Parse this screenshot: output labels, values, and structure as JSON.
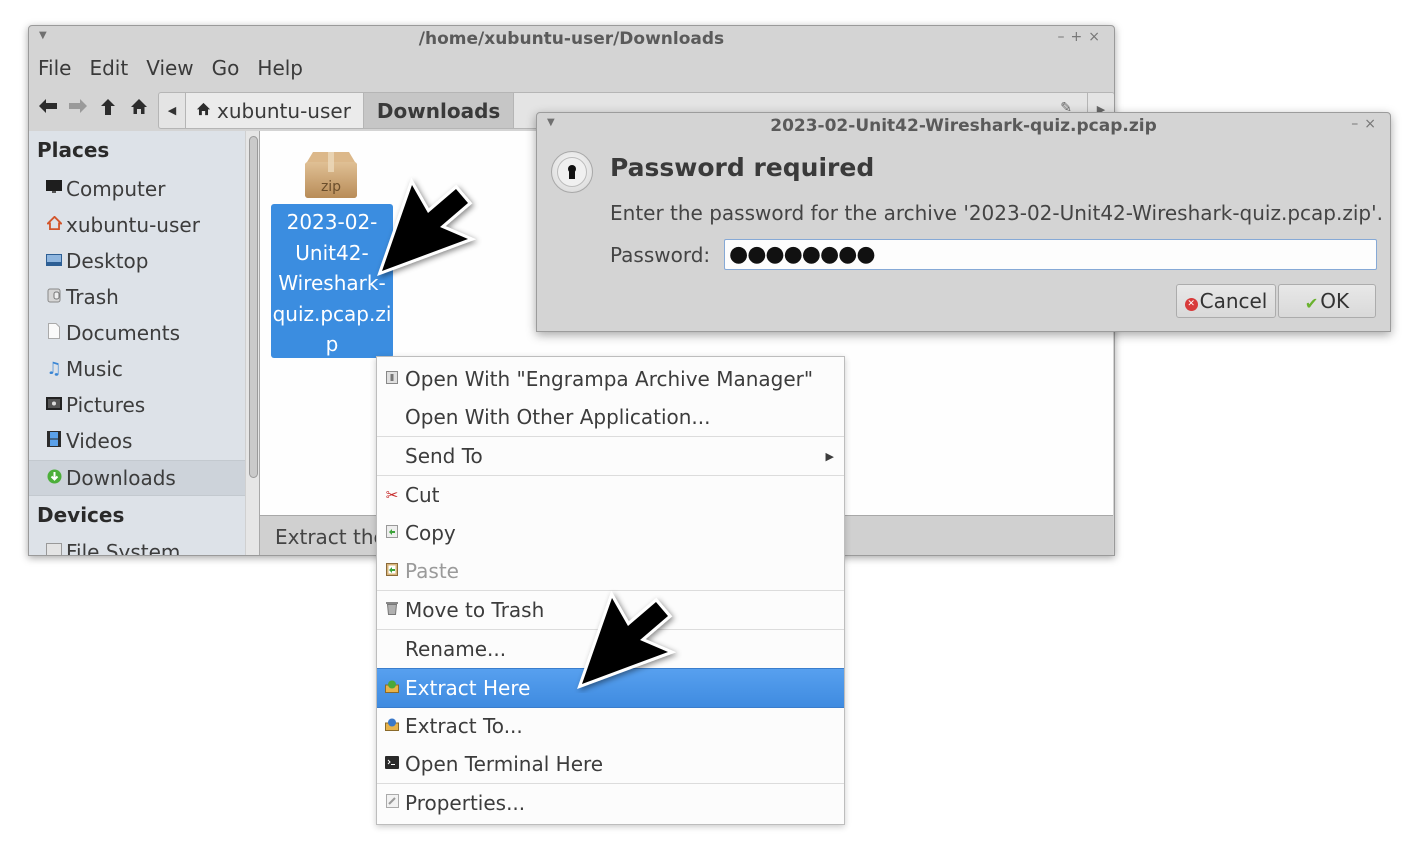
{
  "file_manager": {
    "window_title": "/home/xubuntu-user/Downloads",
    "window_controls": [
      "–",
      "+",
      "×"
    ],
    "menubar": [
      "File",
      "Edit",
      "View",
      "Go",
      "Help"
    ],
    "toolbar": {
      "back_icon": "arrow-left-icon",
      "forward_icon": "arrow-right-icon",
      "up_icon": "arrow-up-icon",
      "home_icon": "home-icon"
    },
    "pathbar": {
      "home_crumb": "xubuntu-user",
      "current_crumb": "Downloads"
    },
    "sidebar": {
      "places_header": "Places",
      "places": [
        {
          "label": "Computer",
          "icon": "computer-icon"
        },
        {
          "label": "xubuntu-user",
          "icon": "home-folder-icon"
        },
        {
          "label": "Desktop",
          "icon": "desktop-icon"
        },
        {
          "label": "Trash",
          "icon": "trash-icon"
        },
        {
          "label": "Documents",
          "icon": "document-icon"
        },
        {
          "label": "Music",
          "icon": "music-icon"
        },
        {
          "label": "Pictures",
          "icon": "pictures-icon"
        },
        {
          "label": "Videos",
          "icon": "videos-icon"
        },
        {
          "label": "Downloads",
          "icon": "downloads-icon",
          "active": true
        }
      ],
      "devices_header": "Devices",
      "devices": [
        {
          "label": "File System",
          "icon": "drive-icon"
        }
      ]
    },
    "files": [
      {
        "name_lines": [
          "2023-02-",
          "Unit42-",
          "Wireshark-",
          "quiz.pcap.zi",
          "p"
        ],
        "name": "2023-02-Unit42-Wireshark-quiz.pcap.zip",
        "type_badge": "zip",
        "selected": true
      }
    ],
    "statusbar": "Extract the"
  },
  "context_menu": {
    "items": [
      {
        "label": "Open With \"Engrampa Archive Manager\"",
        "icon": "archive-manager-icon"
      },
      {
        "label": "Open With Other Application...",
        "icon": ""
      },
      {
        "separator": true
      },
      {
        "label": "Send To",
        "icon": "",
        "submenu": true
      },
      {
        "separator": true
      },
      {
        "label": "Cut",
        "icon": "scissors-icon"
      },
      {
        "label": "Copy",
        "icon": "copy-icon"
      },
      {
        "label": "Paste",
        "icon": "paste-icon",
        "disabled": true
      },
      {
        "separator": true
      },
      {
        "label": "Move to Trash",
        "icon": "trash-icon"
      },
      {
        "label": "Rename...",
        "icon": ""
      },
      {
        "label": "Extract Here",
        "icon": "extract-icon",
        "highlighted": true
      },
      {
        "label": "Extract To...",
        "icon": "extract-to-icon"
      },
      {
        "label": "Open Terminal Here",
        "icon": "terminal-icon"
      },
      {
        "separator": true
      },
      {
        "label": "Properties...",
        "icon": "properties-icon"
      }
    ]
  },
  "password_dialog": {
    "window_title": "2023-02-Unit42-Wireshark-quiz.pcap.zip",
    "window_controls": [
      "–",
      "×"
    ],
    "heading": "Password required",
    "message": "Enter the password for the archive '2023-02-Unit42-Wireshark-quiz.pcap.zip'.",
    "password_label": "Password:",
    "password_value_masked": "●●●●●●●●",
    "cancel_label": "Cancel",
    "ok_label": "OK"
  },
  "colors": {
    "selection_blue": "#3b8de0",
    "menu_highlight": "#4a94e6",
    "window_bg": "#d4d4d4",
    "sidebar_bg": "#dde2e8"
  }
}
